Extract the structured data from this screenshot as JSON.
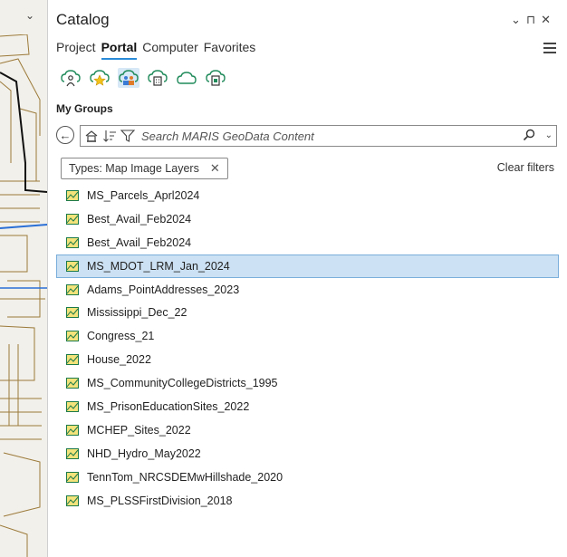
{
  "window": {
    "title": "Catalog",
    "controls": [
      "⌄",
      "⊓",
      "✕"
    ]
  },
  "tabs": [
    {
      "label": "Project",
      "active": false
    },
    {
      "label": "Portal",
      "active": true
    },
    {
      "label": "Computer",
      "active": false
    },
    {
      "label": "Favorites",
      "active": false
    }
  ],
  "portal_icons": [
    {
      "name": "my-content-icon",
      "active": false
    },
    {
      "name": "my-favorites-icon",
      "active": false
    },
    {
      "name": "my-groups-icon",
      "active": true
    },
    {
      "name": "my-organization-icon",
      "active": false
    },
    {
      "name": "arcgis-online-icon",
      "active": false
    },
    {
      "name": "living-atlas-icon",
      "active": false
    }
  ],
  "section": {
    "title": "My Groups"
  },
  "search": {
    "placeholder": "Search MARIS GeoData Content"
  },
  "filter": {
    "chip_label": "Types: Map Image Layers",
    "clear_label": "Clear filters"
  },
  "items": [
    {
      "label": "MS_Parcels_Aprl2024",
      "selected": false
    },
    {
      "label": "Best_Avail_Feb2024",
      "selected": false
    },
    {
      "label": "Best_Avail_Feb2024",
      "selected": false
    },
    {
      "label": "MS_MDOT_LRM_Jan_2024",
      "selected": true
    },
    {
      "label": "Adams_PointAddresses_2023",
      "selected": false
    },
    {
      "label": "Mississippi_Dec_22",
      "selected": false
    },
    {
      "label": "Congress_21",
      "selected": false
    },
    {
      "label": "House_2022",
      "selected": false
    },
    {
      "label": "MS_CommunityCollegeDistricts_1995",
      "selected": false
    },
    {
      "label": "MS_PrisonEducationSites_2022",
      "selected": false
    },
    {
      "label": "MCHEP_Sites_2022",
      "selected": false
    },
    {
      "label": "NHD_Hydro_May2022",
      "selected": false
    },
    {
      "label": "TennTom_NRCSDEMwHillshade_2020",
      "selected": false
    },
    {
      "label": "MS_PLSSFirstDivision_2018",
      "selected": false
    }
  ],
  "colors": {
    "accent": "#2a8bd8",
    "selected_bg": "#cce1f3",
    "highlight": "#fff200",
    "map_line": "#9b7a3a"
  }
}
